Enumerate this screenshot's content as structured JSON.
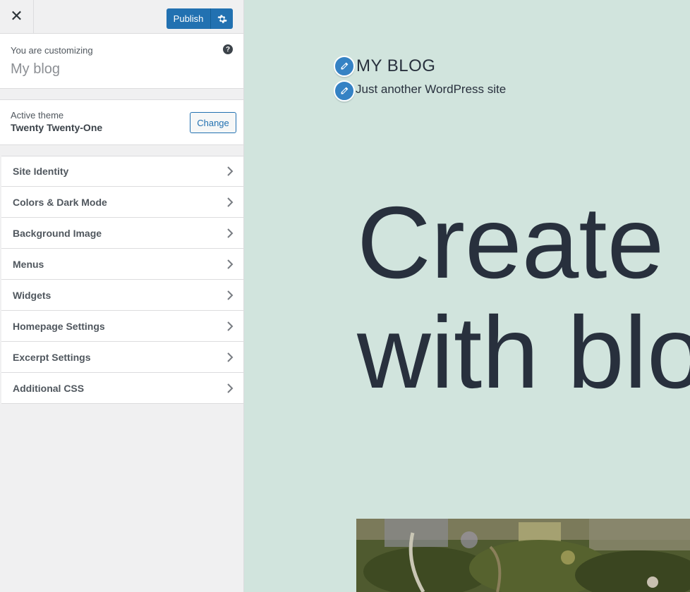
{
  "topbar": {
    "publish_label": "Publish"
  },
  "info": {
    "customizing_label": "You are customizing",
    "site_title": "My blog"
  },
  "theme": {
    "label": "Active theme",
    "name": "Twenty Twenty-One",
    "change_label": "Change"
  },
  "sections": [
    "Site Identity",
    "Colors & Dark Mode",
    "Background Image",
    "Menus",
    "Widgets",
    "Homepage Settings",
    "Excerpt Settings",
    "Additional CSS"
  ],
  "preview": {
    "blog_title": "MY BLOG",
    "tagline": "Just another WordPress site",
    "hero_line1": "Create y",
    "hero_line2": "with blo"
  },
  "colors": {
    "accent": "#2271b1",
    "preview_bg": "#d1e4dd",
    "shortcut": "#3582c4"
  }
}
